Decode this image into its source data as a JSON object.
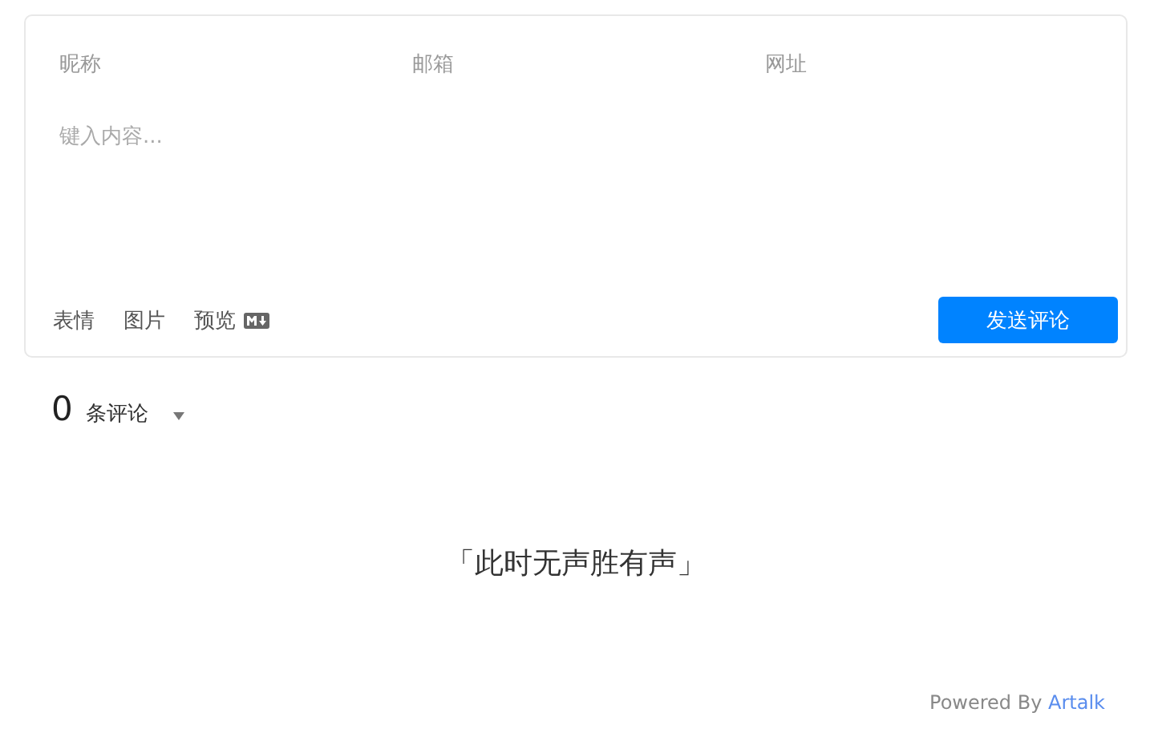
{
  "editor": {
    "fields": [
      {
        "placeholder": "昵称"
      },
      {
        "placeholder": "邮箱"
      },
      {
        "placeholder": "网址"
      }
    ],
    "content": {
      "placeholder": "键入内容..."
    },
    "actions": [
      {
        "label": "表情"
      },
      {
        "label": "图片"
      },
      {
        "label": "预览"
      }
    ],
    "submit": "发送评论"
  },
  "count": {
    "number": "0",
    "label": "条评论"
  },
  "empty_text": "「此时无声胜有声」",
  "footer": {
    "text": "Powered By",
    "link": "Artalk"
  }
}
